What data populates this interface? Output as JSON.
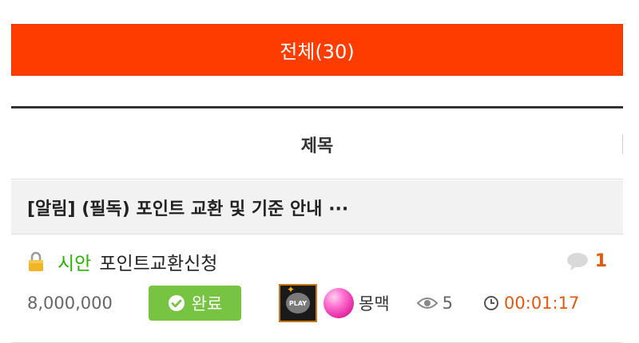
{
  "tab": {
    "label": "전체(30)"
  },
  "table_header": {
    "title_col": "제목"
  },
  "notice": {
    "text": "[알림] (필독) 포인트 교환 및 기준 안내 ···"
  },
  "post": {
    "category": "시안",
    "title": "포인트교환신청",
    "comment_count": "1",
    "price": "8,000,000",
    "status": "완료",
    "play_label": "PLAY",
    "nickname": "몽맥",
    "views": "5",
    "time": "00:01:17"
  },
  "colors": {
    "accent": "#ff3c00",
    "category": "#27b300",
    "status_bg": "#76c442",
    "highlight": "#e8580c"
  },
  "icons": [
    "lock-icon",
    "comment-bubble-icon",
    "check-circle-icon",
    "play-badge-icon",
    "level-orb-icon",
    "eye-icon",
    "clock-icon"
  ]
}
